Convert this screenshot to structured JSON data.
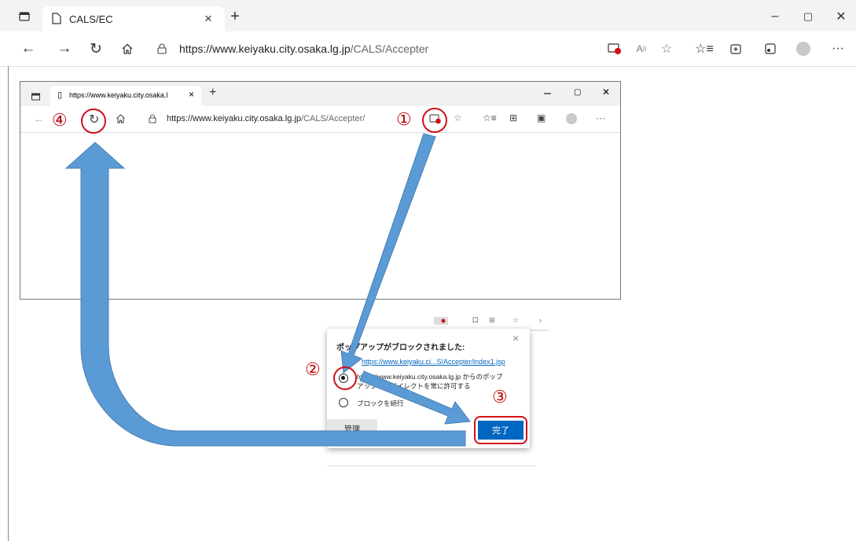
{
  "browser": {
    "tab_title": "CALS/EC",
    "new_tab": "+",
    "window_controls": {
      "minimize": "–",
      "maximize": "▢",
      "close": "✕"
    },
    "url_host": "https://www.keiyaku.city.osaka.lg.jp",
    "url_path": "/CALS/Accepter",
    "more": "···"
  },
  "inner": {
    "tab_title": "https://www.keiyaku.city.osaka.l",
    "url_host": "https://www.keiyaku.city.osaka.lg.jp",
    "url_path": "/CALS/Accepter/",
    "more": "···"
  },
  "popup": {
    "heading": "ポップアップがブロックされました:",
    "blocked_link": "https://www.keiyaku.ci...S/Accepter/index1.jsp",
    "option_allow_line1": "https://www.keiyaku.city.osaka.lg.jp からのポップ",
    "option_allow_line2": "アップとリダイレクトを常に許可する",
    "option_block": "ブロックを続行",
    "manage_label": "管理",
    "done_label": "完了"
  },
  "callouts": [
    "①",
    "②",
    "③",
    "④"
  ],
  "colors": {
    "arrow": "#5b9bd5",
    "arrow_border": "#4a7fb0",
    "highlight": "#d0101a",
    "done_button": "#0067c0"
  }
}
